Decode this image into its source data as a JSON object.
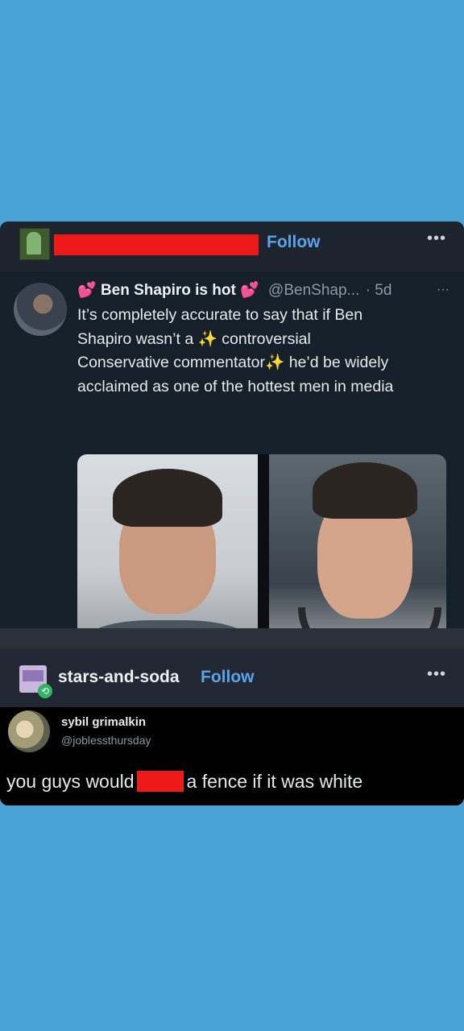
{
  "card1": {
    "header": {
      "follow_label": "Follow",
      "more_label": "•••"
    },
    "tweet": {
      "name": "Ben Shapiro is hot",
      "name_emoji": "💕",
      "handle": "@BenShap...",
      "time": "· 5d",
      "more_label": "···",
      "text_line1": "It’s completely accurate to say that if Ben",
      "text_line2a": "Shapiro wasn’t a ",
      "sparkle": "✨",
      "text_line2b": " controversial",
      "text_line3a": "Conservative commentator",
      "text_line3b": " he’d be widely",
      "text_line4": "acclaimed as one of the hottest men in media"
    }
  },
  "card2": {
    "username": "stars-and-soda",
    "follow_label": "Follow",
    "more_label": "•••",
    "reblog_icon": "⟲",
    "post": {
      "name": "sybil grimalkin",
      "handle": "@joblessthursday",
      "text_before": "you guys would",
      "text_after": "a fence if it was white"
    }
  },
  "colors": {
    "background": "#4aa3d4",
    "redaction": "#ee1a1a",
    "follow": "#5aa3e8"
  }
}
